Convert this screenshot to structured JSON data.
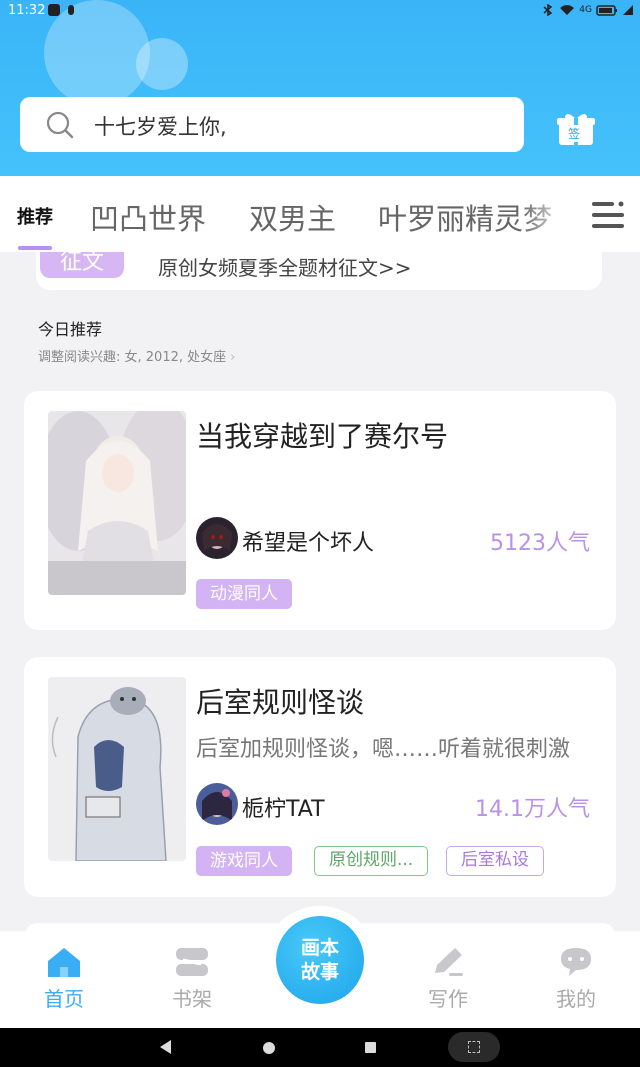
{
  "status_bar": {
    "time": "11:32",
    "right_text": "4G"
  },
  "search": {
    "placeholder": "十七岁爱上你,"
  },
  "gift_label": "签",
  "tabs": {
    "active": "推荐",
    "items": [
      "凹凸世界",
      "双男主",
      "叶罗丽精灵梦"
    ]
  },
  "banner": {
    "tag": "征文",
    "text": "原创女频夏季全题材征文>>"
  },
  "section": {
    "title": "今日推荐",
    "subtitle": "调整阅读兴趣: 女, 2012, 处女座",
    "subtitle_chevron": "›"
  },
  "books": [
    {
      "title": "当我穿越到了赛尔号",
      "description": "",
      "author": "希望是个坏人",
      "popularity": "5123人气",
      "tags": [
        "动漫同人"
      ]
    },
    {
      "title": "后室规则怪谈",
      "description": "后室加规则怪谈，嗯……听着就很刺激",
      "author": "栀柠TAT",
      "popularity": "14.1万人气",
      "tags": [
        "游戏同人",
        "原创规则...",
        "后室私设"
      ]
    }
  ],
  "bottom_nav": {
    "home": "首页",
    "shelf": "书架",
    "center": [
      "画本",
      "故事"
    ],
    "write": "写作",
    "me": "我的"
  },
  "colors": {
    "primary": "#3ab4f7",
    "accent_purple": "#b992e8",
    "tag_fill": "#d3b3f3"
  }
}
